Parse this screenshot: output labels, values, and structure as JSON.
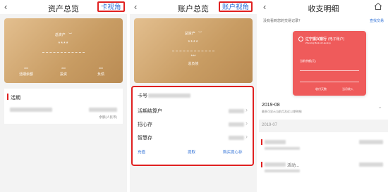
{
  "screen1": {
    "back_icon": "chevron-left-icon",
    "title": "资产总览",
    "toggle": "卡视角",
    "card_label": "总资产",
    "card_masked": "****",
    "stats": [
      {
        "value": "***",
        "label": "活期余额"
      },
      {
        "value": "***",
        "label": "投资"
      },
      {
        "value": "***",
        "label": "负债"
      }
    ],
    "section_title": "活期",
    "sub_note": "余额(人民币)"
  },
  "screen2": {
    "back_icon": "chevron-left-icon",
    "title": "账户总览",
    "toggle": "账户视角",
    "card_label": "总资产",
    "card_masked": "****",
    "card_masked2": "***",
    "card_sub": "总负债",
    "card_no_prefix": "卡号",
    "rows": [
      "活期结算户",
      "招心存",
      "智慧存"
    ],
    "links": {
      "left": "充值",
      "center": "提取",
      "right": "购买提心存"
    }
  },
  "screen3": {
    "back_icon": "chevron-left-icon",
    "title": "收支明细",
    "home_icon": "home-icon",
    "search_hint": "没有看到您的交易记录？",
    "search_link": "查找交易",
    "bank_name": "辽宁振兴银行",
    "bank_suffix": "(电子账户)",
    "bank_en": "Zhenxing Bank of Liaoning",
    "card_field1": "当前余额(元)",
    "card_field2_left": "收付天数",
    "card_field2_right": "当月收入",
    "month1": "2019-08",
    "month1_note": "最多可显示当前月及近12期明细",
    "month2": "2019-07",
    "row_text": "活动..."
  }
}
